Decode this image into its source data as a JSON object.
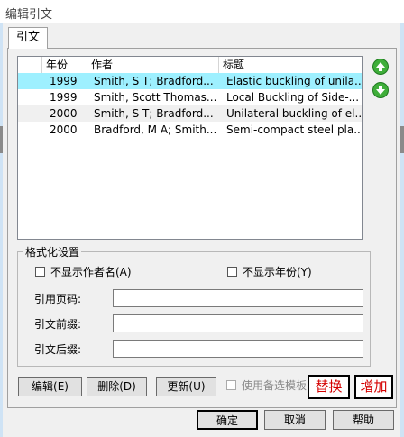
{
  "window": {
    "title": "编辑引文"
  },
  "tabs": [
    {
      "label": "引文"
    }
  ],
  "list": {
    "columns": [
      "年份",
      "作者",
      "标题"
    ],
    "rows": [
      {
        "year": "1999",
        "author": "Smith, S T; Bradford...",
        "title": "Elastic buckling of unila...",
        "selected": true
      },
      {
        "year": "1999",
        "author": "Smith, Scott Thomas...",
        "title": "Local Buckling of Side-...",
        "selected": false
      },
      {
        "year": "2000",
        "author": "Smith, S T; Bradford...",
        "title": "Unilateral buckling of el...",
        "selected": false
      },
      {
        "year": "2000",
        "author": "Bradford, M A; Smith...",
        "title": "Semi-compact steel pla...",
        "selected": false
      }
    ],
    "move_up_icon": "arrow-up-circle-icon",
    "move_down_icon": "arrow-down-circle-icon"
  },
  "format": {
    "legend": "格式化设置",
    "hide_author_label": "不显示作者名(A)",
    "hide_year_label": "不显示年份(Y)",
    "page_label": "引用页码:",
    "prefix_label": "引文前缀:",
    "suffix_label": "引文后缀:",
    "page_value": "",
    "prefix_value": "",
    "suffix_value": ""
  },
  "actions": {
    "edit": "编辑(E)",
    "delete": "删除(D)",
    "update": "更新(U)",
    "use_template": "使用备选模板",
    "replace": "替换",
    "add": "增加"
  },
  "footer": {
    "ok": "确定",
    "cancel": "取消",
    "help": "帮助"
  },
  "colors": {
    "selected_row": "#9ef0ff",
    "alt_row": "#f0f0f0",
    "red_text": "#d40000",
    "icon_green": "#3fae3a"
  }
}
